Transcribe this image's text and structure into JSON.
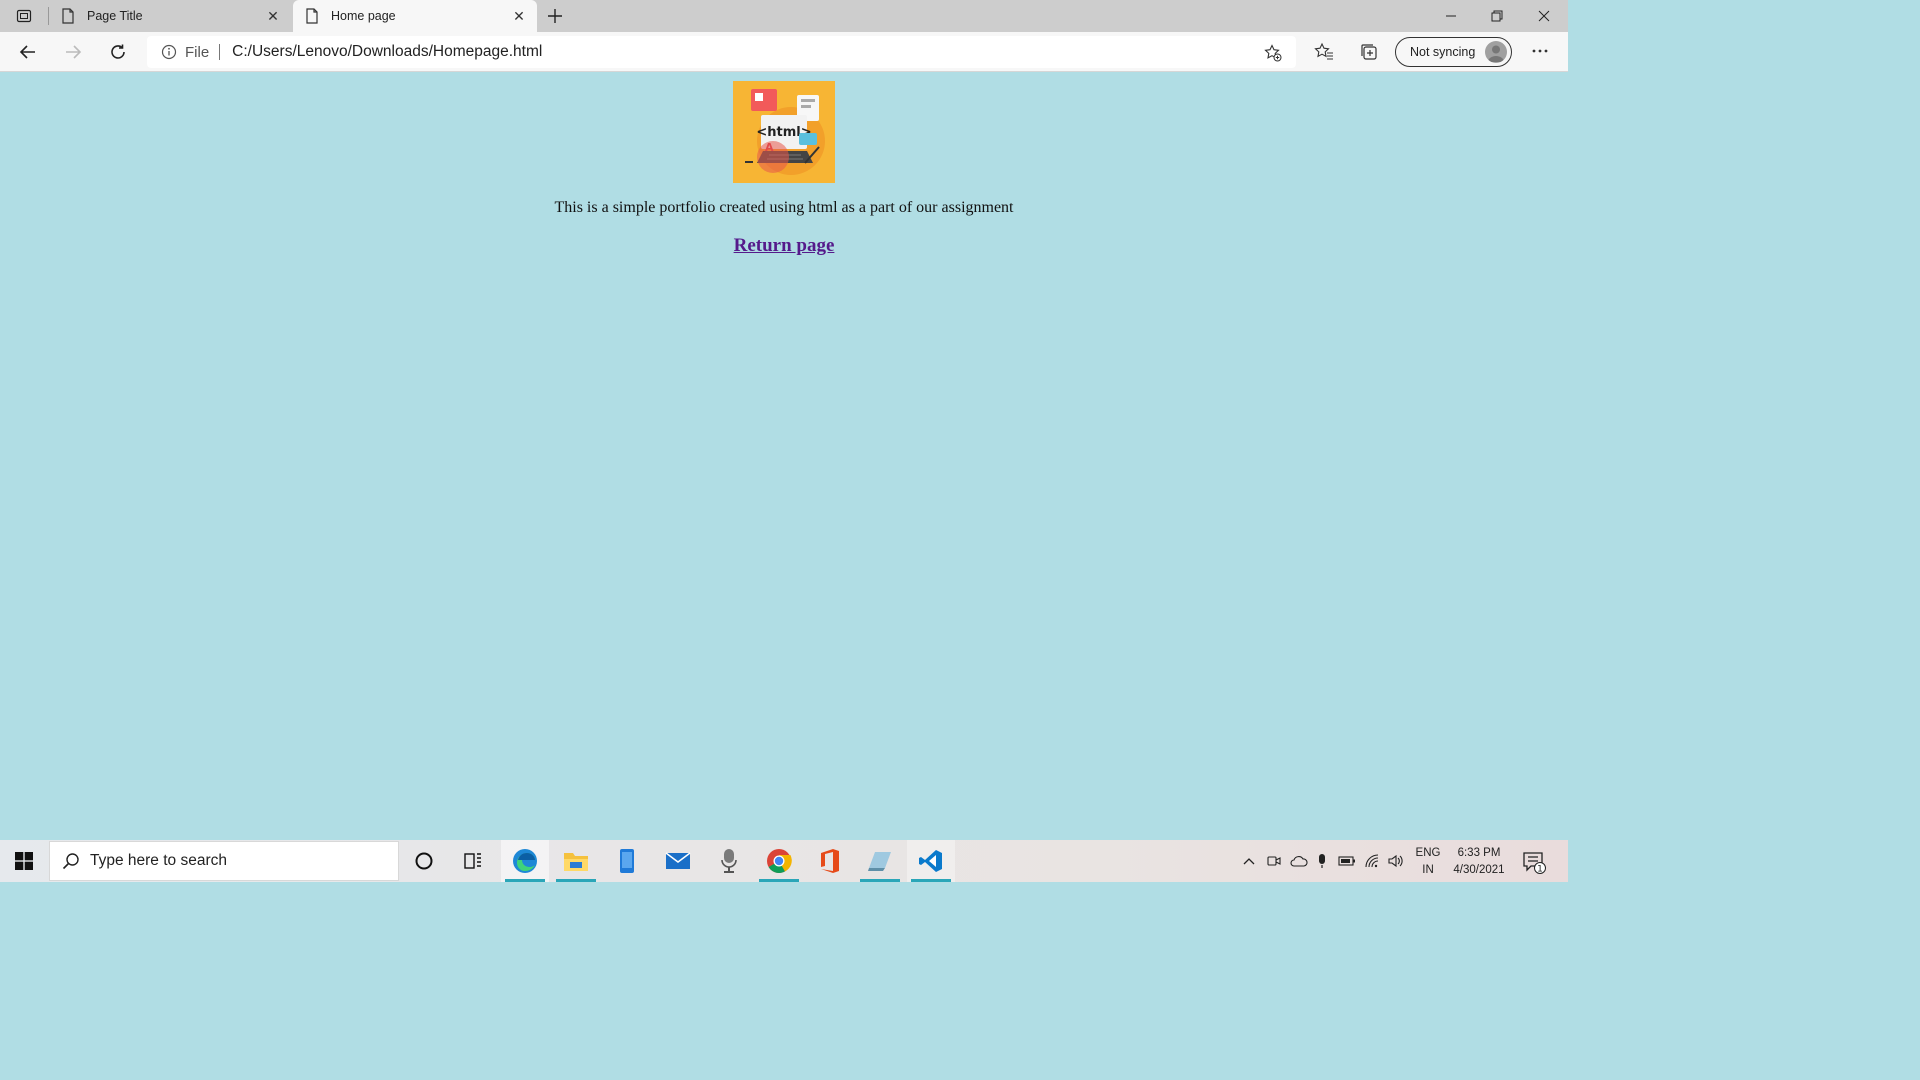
{
  "browser": {
    "tabs": [
      {
        "label": "Page Title",
        "active": false
      },
      {
        "label": "Home page",
        "active": true
      }
    ],
    "address": {
      "scheme_label": "File",
      "url": "C:/Users/Lenovo/Downloads/Homepage.html"
    },
    "sync_label": "Not syncing"
  },
  "page": {
    "background": "#b0dde4",
    "image_text": "<html>",
    "description": "This is a simple portfolio created using html as a part of our assignment",
    "link_label": "Return page",
    "link_color": "#551a8b"
  },
  "taskbar": {
    "search_placeholder": "Type here to search",
    "apps": [
      "edge-icon",
      "file-explorer-icon",
      "phone-icon",
      "mail-icon",
      "microphone-app-icon",
      "chrome-icon",
      "office-icon",
      "sketch-app-icon",
      "vscode-icon"
    ],
    "language_line1": "ENG",
    "language_line2": "IN",
    "time": "6:33 PM",
    "date": "4/30/2021",
    "notification_count": "1"
  }
}
